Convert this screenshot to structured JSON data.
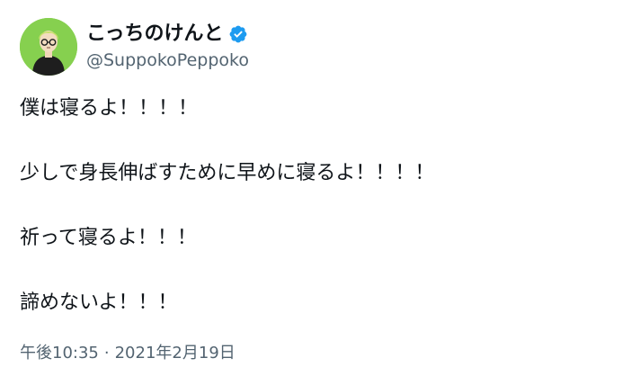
{
  "user": {
    "display_name": "こっちのけんと",
    "handle": "@SuppokoPeppoko",
    "verified": true,
    "verified_icon": "verified-badge-icon",
    "avatar_bg": "#86d04f",
    "verified_color": "#1d9bf0"
  },
  "tweet": {
    "lines": [
      "僕は寝るよ！！！！",
      "少しで身長伸ばすために早めに寝るよ！！！！",
      "祈って寝るよ！！！",
      "諦めないよ！！！"
    ],
    "time": "午後10:35",
    "separator": "·",
    "date": "2021年2月19日"
  }
}
